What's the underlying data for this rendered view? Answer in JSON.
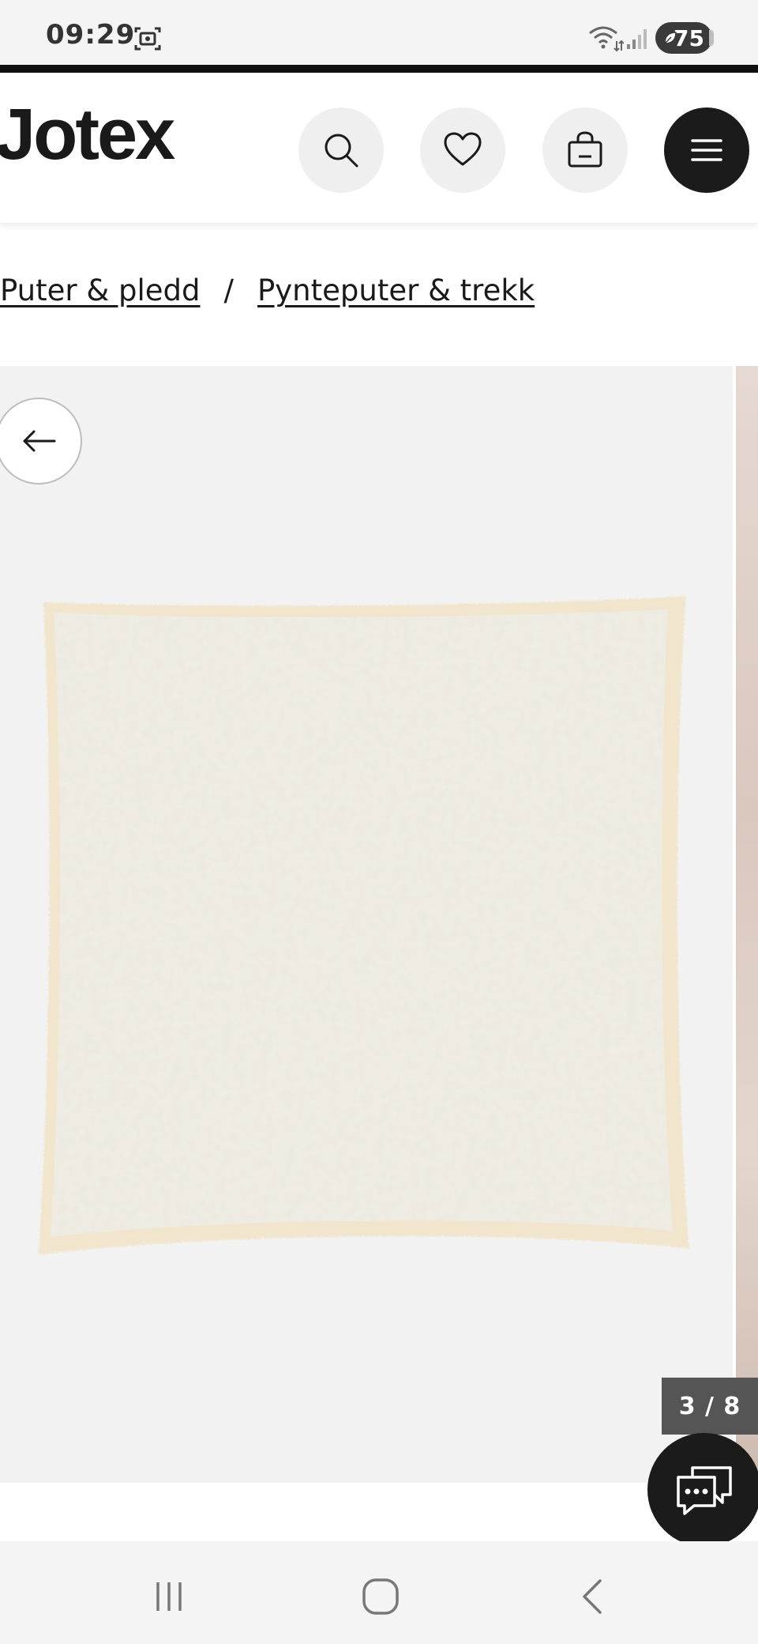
{
  "status_bar": {
    "time": "09:29",
    "battery_level": "75",
    "icons": [
      "screenshot-icon",
      "wifi-icon",
      "signal-icon",
      "battery-icon"
    ]
  },
  "header": {
    "logo": "Jotex",
    "buttons": [
      "search-icon",
      "heart-icon",
      "shopping-bag-icon",
      "menu-icon"
    ]
  },
  "breadcrumb": {
    "items": [
      {
        "label": "Puter & pledd"
      },
      {
        "label": "Pynteputer & trekk"
      }
    ],
    "separator": "/"
  },
  "gallery": {
    "counter": "3 / 8",
    "current_image": 3,
    "total_images": 8,
    "background": "#f2f2f2",
    "product_color": "#efe9dc"
  },
  "chat": {
    "icon": "chat-bubble-icon"
  },
  "nav_bar": {
    "buttons": [
      "recents-icon",
      "home-icon",
      "back-icon"
    ]
  },
  "colors": {
    "dark": "#1b1b1b",
    "button_bg": "#efefef",
    "counter_bg": "#555555"
  }
}
